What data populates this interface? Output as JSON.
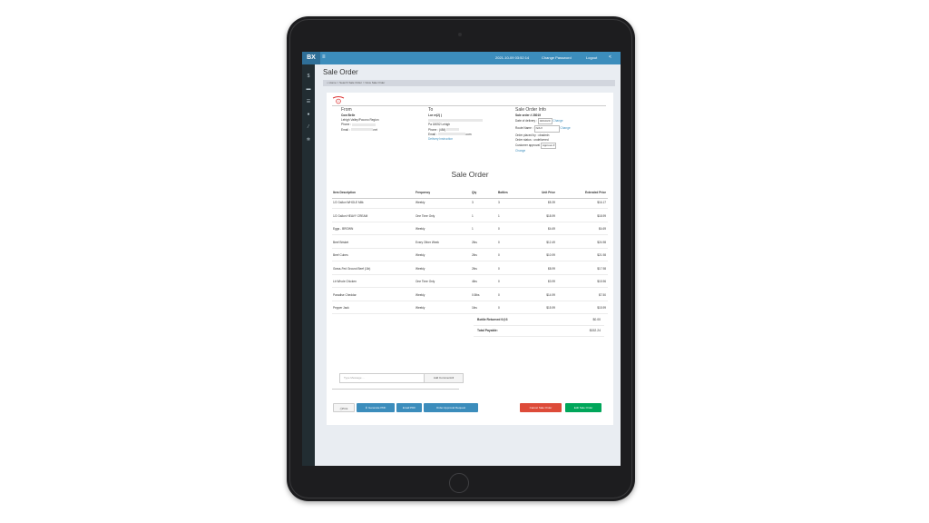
{
  "topbar": {
    "brand": "BX",
    "datetime": "2021-10-09 03:52:14",
    "change_password": "Change Password",
    "logout": "Logout"
  },
  "page": {
    "title": "Sale Order",
    "breadcrumb": [
      "Home",
      "Search Sale Order",
      "View Sale Order"
    ]
  },
  "from": {
    "heading": "From",
    "name": "Cow Belle",
    "region": "Lehigh Valley/Pocono Region",
    "phone_label": "Phone :",
    "email_label": "Email :",
    "email_suffix": ".net"
  },
  "to": {
    "heading": "To",
    "name": "Lor er(2( )",
    "address": "Pa 18052 Lehigh",
    "phone": "Phone : (484)",
    "email_label": "Email :",
    "email_suffix": ".com",
    "delivery_link": "Delivery Instruction"
  },
  "info": {
    "heading": "Sale Order Info",
    "order_no": "Sale order # 28019",
    "date_label": "Date of delivery :",
    "date_value": "02/10/20",
    "change": "Change",
    "route_label": "Route Name :",
    "route_value": "N/A",
    "placed_by": "Order placed by : cbadmin",
    "status": "Order status : undelivered",
    "approval_label": "Customer approval",
    "approval_value": "Approve"
  },
  "order": {
    "section_title": "Sale Order",
    "columns": [
      "Item Description",
      "Frequency",
      "Qty",
      "Bottles",
      "Unit Price",
      "Extended Price"
    ],
    "rows": [
      [
        "1/2 Gallon WHOLE Milk",
        "Weekly",
        "3",
        "3",
        "$5.39",
        "$16.17"
      ],
      [
        "1/2 Gallon HEAVY CREAM",
        "One Time Only",
        "1",
        "1",
        "$18.99",
        "$18.99"
      ],
      [
        "Eggs - BROWN",
        "Weekly",
        "1",
        "0",
        "$4.69",
        "$4.69"
      ],
      [
        "Beef Brisket",
        "Every Other Week",
        "2lbs",
        "0",
        "$12.49",
        "$24.98"
      ],
      [
        "Beef Cubes",
        "Weekly",
        "2lbs",
        "0",
        "$10.99",
        "$21.98"
      ],
      [
        "Grass-Fed Ground Beef (1lb)",
        "Weekly",
        "2lbs",
        "0",
        "$8.99",
        "$17.98"
      ],
      [
        "Lb Whole Chicken",
        "One Time Only",
        "4lbs",
        "0",
        "$3.99",
        "$15.96"
      ],
      [
        "Paradise Cheddar",
        "Weekly",
        "0.5lbs",
        "0",
        "$14.99",
        "$7.50"
      ],
      [
        "Pepper Jack",
        "Weekly",
        "1lbs",
        "0",
        "$15.99",
        "$15.99"
      ]
    ],
    "bottle_returned_label": "Bottle Returned 0@3",
    "bottle_returned_value": "$0.00",
    "total_label": "Total Payable:",
    "total_value": "$152.24"
  },
  "comment": {
    "placeholder": "Type Message ...",
    "add_button": "Add Comments"
  },
  "actions": {
    "print": "Print",
    "generate_pdf": "Generate PDF",
    "email_pdf": "Email PDF",
    "approval_request": "Order Approval Request",
    "cancel": "Cancel Sale Order",
    "edit": "Edit Sale Order"
  },
  "colors": {
    "topbar": "#3c8dbc",
    "sidebar": "#222d32",
    "cancel": "#dd4b39",
    "edit": "#00a65a"
  }
}
